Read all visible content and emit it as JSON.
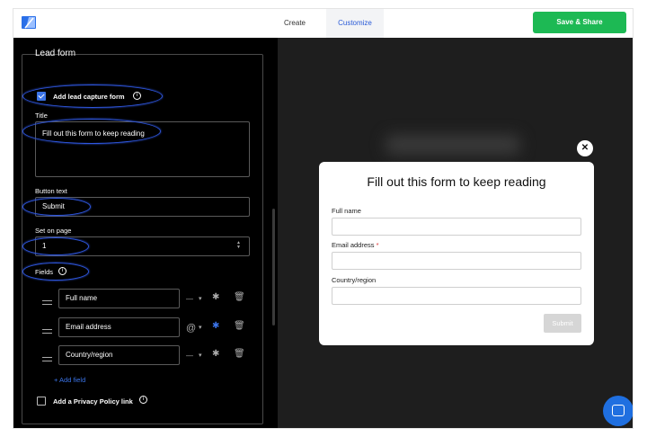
{
  "header": {
    "tabs": [
      {
        "label": "Create",
        "active": false
      },
      {
        "label": "Customize",
        "active": true
      }
    ],
    "share_button": "Save & Share"
  },
  "lead_form": {
    "heading": "Lead form",
    "add_lead_capture": {
      "label": "Add lead capture form",
      "checked": true
    },
    "title_label": "Title",
    "title_value": "Fill out this form to keep reading",
    "button_text_label": "Button text",
    "button_text_value": "Submit",
    "set_on_page_label": "Set on page",
    "set_on_page_value": "1",
    "fields_label": "Fields",
    "fields": [
      {
        "name": "Full name",
        "type_symbol": "—",
        "required": false
      },
      {
        "name": "Email address",
        "type_symbol": "@",
        "required": true
      },
      {
        "name": "Country/region",
        "type_symbol": "—",
        "required": false
      }
    ],
    "add_field": "+ Add field",
    "privacy": {
      "label": "Add a Privacy Policy link",
      "checked": false
    }
  },
  "preview": {
    "title": "Fill out this form to keep reading",
    "fields": [
      {
        "label": "Full name",
        "required_mark": ""
      },
      {
        "label": "Email address",
        "required_mark": "*"
      },
      {
        "label": "Country/region",
        "required_mark": ""
      }
    ],
    "submit": "Submit",
    "close_symbol": "✕"
  },
  "colors": {
    "accent": "#2a5bd7",
    "share_green": "#1db954",
    "annotation_blue": "#2f57e0",
    "chat_blue": "#1f6fe0"
  },
  "icons": [
    "logo-icon",
    "info-icon",
    "drag-handle-icon",
    "chevron-down-icon",
    "required-asterisk-icon",
    "trash-icon",
    "close-icon",
    "chat-icon",
    "stepper-icon"
  ]
}
